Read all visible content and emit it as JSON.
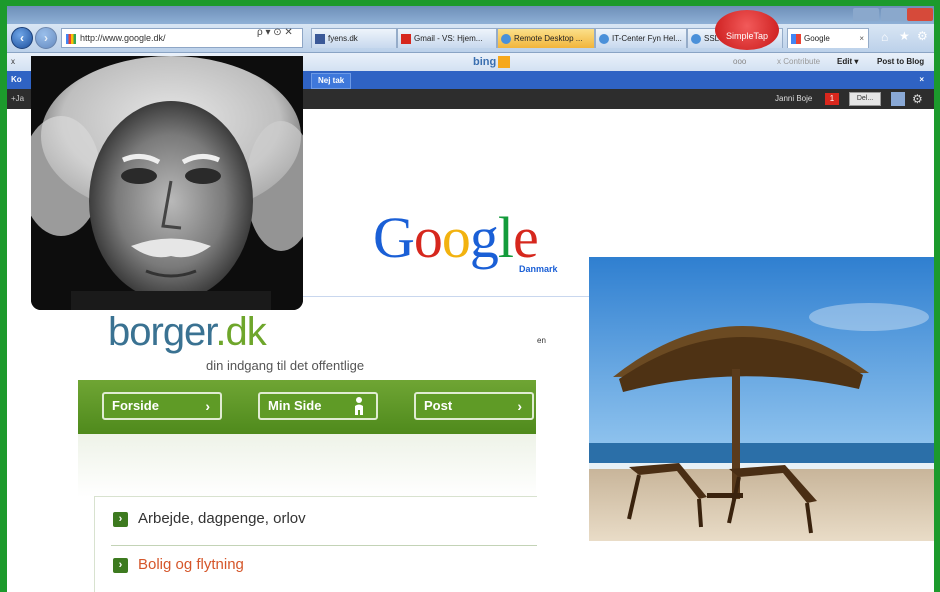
{
  "browser": {
    "url": "http://www.google.dk/",
    "url_controls": "ρ ▾ ⊙ ✕",
    "tabs": [
      {
        "label": "fyens.dk",
        "icon": "facebook-icon"
      },
      {
        "label": "Gmail - VS: Hjem...",
        "icon": "gmail-icon"
      },
      {
        "label": "Remote Desktop ...",
        "icon": "ie-icon"
      },
      {
        "label": "IT-Center Fyn Hel...",
        "icon": "ie-icon"
      },
      {
        "label": "SSL VPN",
        "icon": "ie-icon"
      },
      {
        "label": "Google",
        "icon": "google-icon"
      }
    ],
    "simpletap": "SimpleTap",
    "toolbar": {
      "close": "x",
      "lenovo": "lenovo",
      "bing": "bing",
      "search_box_value": "ooo",
      "contribute": "x  Contribute",
      "edit": "Edit ▾",
      "post": "Post to Blog"
    }
  },
  "google": {
    "bluebar_left": "Ko",
    "neitak": "Nej tak",
    "bluebar_close": "×",
    "blackbar_left": "+Ja",
    "user_name": "Janni Boje",
    "notification_count": "1",
    "share_button": "Del...",
    "logo_letters": [
      "G",
      "o",
      "o",
      "g",
      "l",
      "e"
    ],
    "country": "Danmark",
    "snippet": "en"
  },
  "borger": {
    "logo_main": "borger",
    "logo_dk": ".dk",
    "tagline": "din indgang til det offentlige",
    "nav": [
      {
        "label": "Forside",
        "glyph": "›"
      },
      {
        "label": "Min Side",
        "glyph": "person-icon"
      },
      {
        "label": "Post",
        "glyph": "›"
      }
    ],
    "list": [
      {
        "label": "Arbejde, dagpenge, orlov",
        "color": "#333333"
      },
      {
        "label": "Bolig og flytning",
        "color": "#d5562a"
      }
    ]
  },
  "colors": {
    "border_green": "#1c9a2c",
    "google_blue_bar": "#2f63c4",
    "borger_green": "#5f9b26",
    "borger_blue": "#3a7292"
  }
}
